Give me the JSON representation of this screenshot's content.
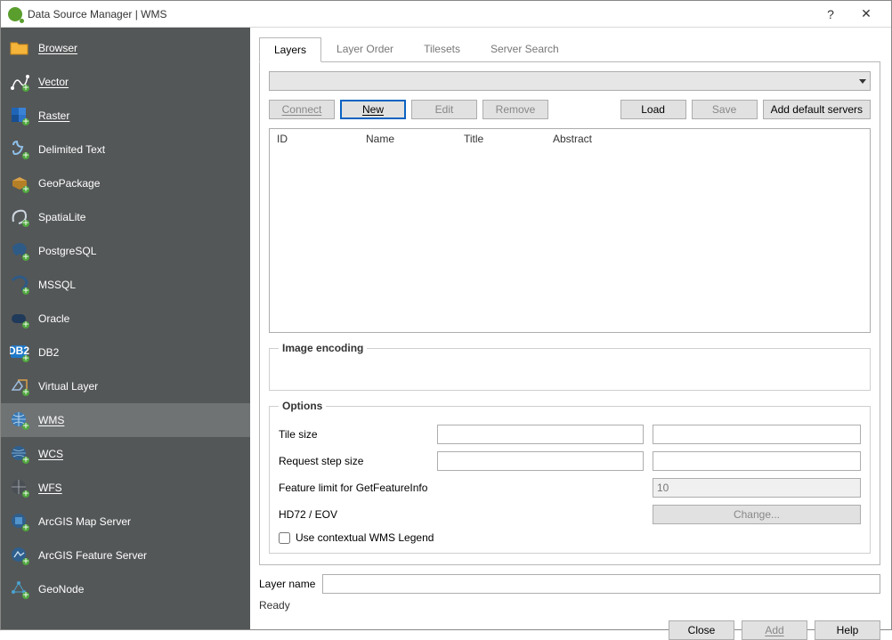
{
  "window": {
    "title": "Data Source Manager | WMS"
  },
  "sidebar": {
    "items": [
      {
        "label": "Browser",
        "acc": true
      },
      {
        "label": "Vector",
        "acc": true
      },
      {
        "label": "Raster",
        "acc": true
      },
      {
        "label": "Delimited Text",
        "acc": false
      },
      {
        "label": "GeoPackage",
        "acc": false
      },
      {
        "label": "SpatiaLite",
        "acc": false
      },
      {
        "label": "PostgreSQL",
        "acc": false
      },
      {
        "label": "MSSQL",
        "acc": false
      },
      {
        "label": "Oracle",
        "acc": false
      },
      {
        "label": "DB2",
        "acc": false
      },
      {
        "label": "Virtual Layer",
        "acc": false
      },
      {
        "label": "WMS",
        "acc": true,
        "selected": true
      },
      {
        "label": "WCS",
        "acc": true
      },
      {
        "label": "WFS",
        "acc": true
      },
      {
        "label": "ArcGIS Map Server",
        "acc": false
      },
      {
        "label": "ArcGIS Feature Server",
        "acc": false
      },
      {
        "label": "GeoNode",
        "acc": false
      }
    ]
  },
  "tabs": {
    "layers": "Layers",
    "order": "Layer Order",
    "tilesets": "Tilesets",
    "search": "Server Search"
  },
  "buttons": {
    "connect": "Connect",
    "new": "New",
    "edit": "Edit",
    "remove": "Remove",
    "load": "Load",
    "save": "Save",
    "adddefault": "Add default servers",
    "close": "Close",
    "add": "Add",
    "help": "Help",
    "change": "Change..."
  },
  "columns": {
    "id": "ID",
    "name": "Name",
    "title": "Title",
    "abstract": "Abstract"
  },
  "groups": {
    "imgenc": "Image encoding",
    "options": "Options"
  },
  "options": {
    "tilesize": "Tile size",
    "stepsize": "Request step size",
    "featlimit": "Feature limit for GetFeatureInfo",
    "featlimit_val": "10",
    "crs": "HD72 / EOV",
    "contextual": "Use contextual WMS Legend"
  },
  "layername_label": "Layer name",
  "status": "Ready"
}
